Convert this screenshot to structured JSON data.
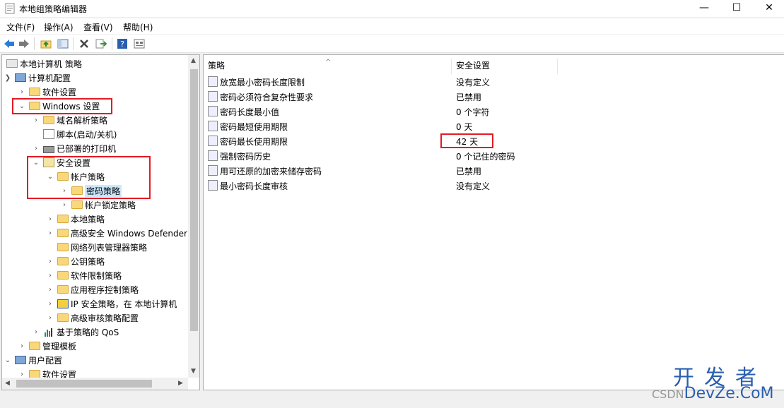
{
  "window": {
    "title": "本地组策略编辑器",
    "minimize": "—",
    "maximize": "☐",
    "close": "✕"
  },
  "menu": [
    "文件(F)",
    "操作(A)",
    "查看(V)",
    "帮助(H)"
  ],
  "toolbar": {
    "icons": [
      "back-arrow-icon",
      "forward-arrow-icon",
      "up-folder-icon",
      "show-hide-tree-icon",
      "delete-icon",
      "export-list-icon",
      "help-icon",
      "properties-view-icon"
    ]
  },
  "tree": {
    "items": [
      {
        "label": "本地计算机 策略",
        "icon": "computer-policy-icon",
        "arrow": ""
      },
      {
        "label": "计算机配置",
        "icon": "computer-icon",
        "arrow": "▼"
      },
      {
        "label": "软件设置",
        "icon": "folder-icon",
        "arrow": "›"
      },
      {
        "label": "Windows 设置",
        "icon": "folder-icon",
        "arrow": "▼"
      },
      {
        "label": "域名解析策略",
        "icon": "folder-icon",
        "arrow": "›"
      },
      {
        "label": "脚本(启动/关机)",
        "icon": "script-icon",
        "arrow": ""
      },
      {
        "label": "已部署的打印机",
        "icon": "printer-icon",
        "arrow": "›"
      },
      {
        "label": "安全设置",
        "icon": "security-icon",
        "arrow": "▼"
      },
      {
        "label": "帐户策略",
        "icon": "lock-folder-icon",
        "arrow": "▼"
      },
      {
        "label": "密码策略",
        "icon": "lock-folder-icon",
        "arrow": "›"
      },
      {
        "label": "帐户锁定策略",
        "icon": "lock-folder-icon",
        "arrow": "›"
      },
      {
        "label": "本地策略",
        "icon": "lock-folder-icon",
        "arrow": "›"
      },
      {
        "label": "高级安全 Windows Defender",
        "icon": "folder-icon",
        "arrow": "›"
      },
      {
        "label": "网络列表管理器策略",
        "icon": "folder-icon",
        "arrow": ""
      },
      {
        "label": "公钥策略",
        "icon": "folder-icon",
        "arrow": "›"
      },
      {
        "label": "软件限制策略",
        "icon": "folder-icon",
        "arrow": "›"
      },
      {
        "label": "应用程序控制策略",
        "icon": "folder-icon",
        "arrow": "›"
      },
      {
        "label": "IP 安全策略，在 本地计算机",
        "icon": "ip-security-icon",
        "arrow": "›"
      },
      {
        "label": "高级审核策略配置",
        "icon": "folder-icon",
        "arrow": "›"
      },
      {
        "label": "基于策略的 QoS",
        "icon": "qos-chart-icon",
        "arrow": "›"
      },
      {
        "label": "管理模板",
        "icon": "folder-icon",
        "arrow": "›"
      },
      {
        "label": "用户配置",
        "icon": "user-icon",
        "arrow": "▼"
      },
      {
        "label": "软件设置",
        "icon": "folder-icon",
        "arrow": "›"
      }
    ]
  },
  "list": {
    "columns": [
      "策略",
      "安全设置"
    ],
    "rows": [
      {
        "policy": "放宽最小密码长度限制",
        "setting": "没有定义"
      },
      {
        "policy": "密码必须符合复杂性要求",
        "setting": "已禁用"
      },
      {
        "policy": "密码长度最小值",
        "setting": "0 个字符"
      },
      {
        "policy": "密码最短使用期限",
        "setting": "0 天"
      },
      {
        "policy": "密码最长使用期限",
        "setting": "42 天"
      },
      {
        "policy": "强制密码历史",
        "setting": "0 个记住的密码"
      },
      {
        "policy": "用可还原的加密来储存密码",
        "setting": "已禁用"
      },
      {
        "policy": "最小密码长度审核",
        "setting": "没有定义"
      }
    ]
  },
  "watermark": {
    "top": "开发者",
    "csdn": "CSDN",
    "bottom": "DevZe.CoM"
  },
  "colors": {
    "highlight": "#e31b23",
    "selection": "#cce8ff",
    "folder": "#f9d77b"
  }
}
